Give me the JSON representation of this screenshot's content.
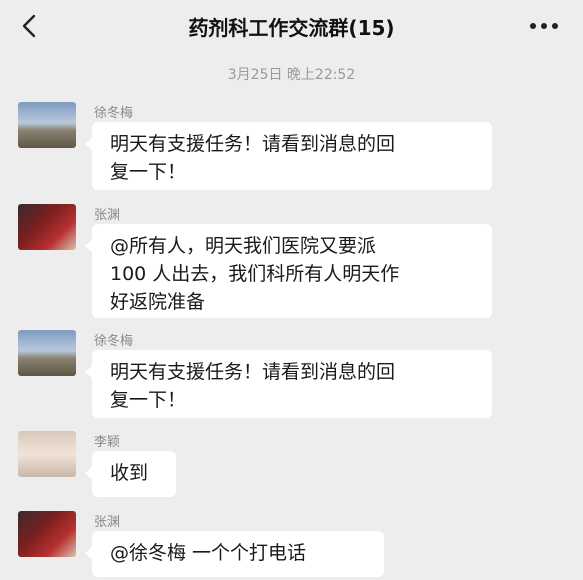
{
  "header": {
    "title": "药剂科工作交流群(15)",
    "back_icon": "chevron-left-icon",
    "more_icon": "more-dots-icon"
  },
  "timestamp": "3月25日 晚上22:52",
  "messages": [
    {
      "sender": "徐冬梅",
      "avatar": "mountain-landscape",
      "lines": [
        "明天有支援任务！请看到消息的回",
        "复一下！"
      ]
    },
    {
      "sender": "张渊",
      "avatar": "red-clothing-photo",
      "lines": [
        "@所有人，明天我们医院又要派",
        "100 人出去，我们科所有人明天作",
        "好返院准备"
      ]
    },
    {
      "sender": "徐冬梅",
      "avatar": "mountain-landscape",
      "lines": [
        "明天有支援任务！请看到消息的回",
        "复一下！"
      ]
    },
    {
      "sender": "李颖",
      "avatar": "girl-portrait",
      "lines": [
        "收到"
      ]
    },
    {
      "sender": "张渊",
      "avatar": "red-clothing-photo",
      "lines": [
        "@徐冬梅  一个个打电话"
      ]
    }
  ]
}
